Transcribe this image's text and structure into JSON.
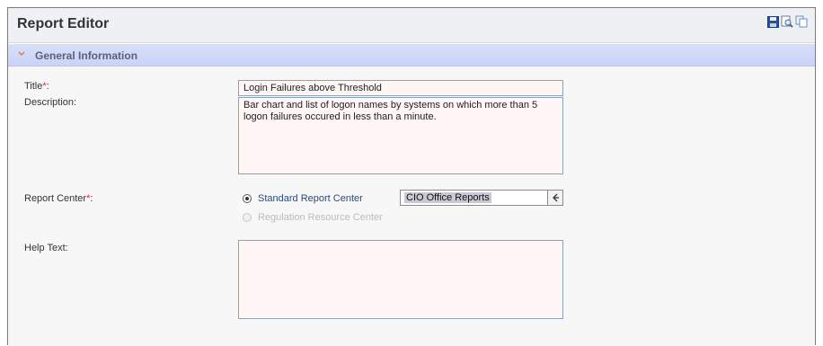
{
  "app": {
    "title": "Report Editor"
  },
  "toolbar": {
    "icons": [
      "save-icon",
      "preview-icon",
      "copy-icon"
    ]
  },
  "section": {
    "title": "General Information",
    "expanded": true
  },
  "form": {
    "title_label": "Title",
    "title_value": "Login Failures above Threshold",
    "description_label": "Description:",
    "description_value": "Bar chart and list of logon names by systems on which more than 5 logon failures occured in less than a minute.",
    "report_center_label": "Report Center",
    "report_center_options": [
      {
        "label": "Standard Report Center",
        "selected": true,
        "enabled": true
      },
      {
        "label": "Regulation Resource Center",
        "selected": false,
        "enabled": false
      }
    ],
    "report_center_select": "CIO Office Reports",
    "help_text_label": "Help Text:",
    "help_text_value": "",
    "required_marker": "*",
    "colon": ":"
  },
  "colors": {
    "required": "#dd2233",
    "section_bar": "#cdd6f7",
    "field_bg": "#fff5f5"
  }
}
